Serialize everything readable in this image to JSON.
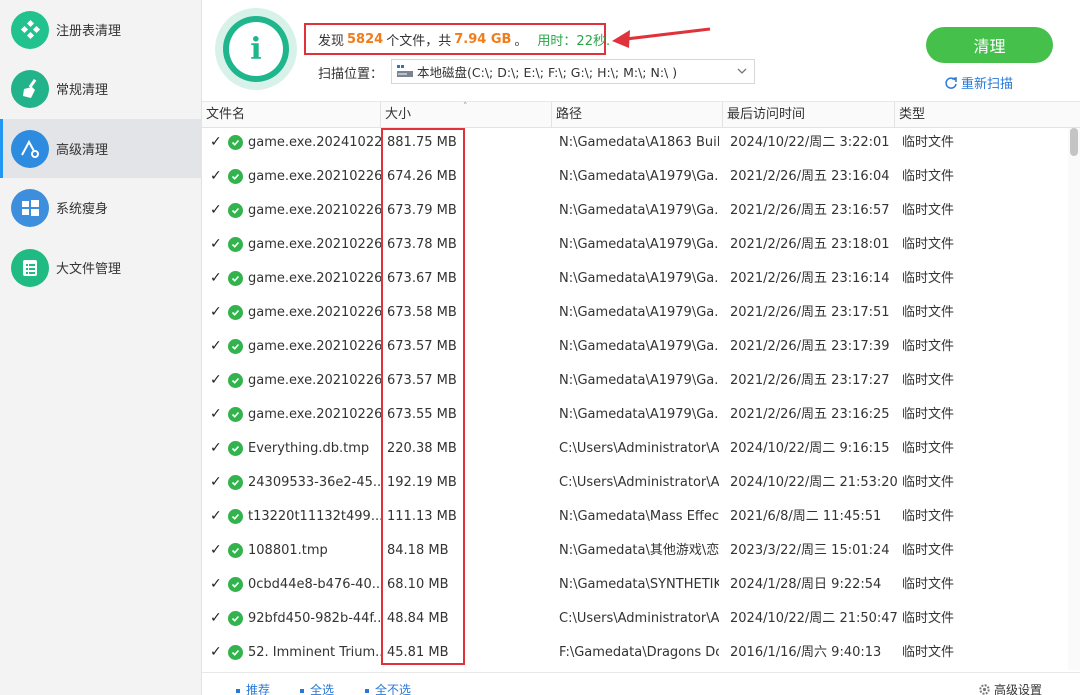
{
  "sidebar": {
    "items": [
      {
        "label": "注册表清理",
        "icon": "registry-icon",
        "color": "#22c28f"
      },
      {
        "label": "常规清理",
        "icon": "broom-icon",
        "color": "#22b38a"
      },
      {
        "label": "高级清理",
        "icon": "advanced-clean-icon",
        "color": "#2d8be0"
      },
      {
        "label": "系统瘦身",
        "icon": "windows-icon",
        "color": "#3d8fdd"
      },
      {
        "label": "大文件管理",
        "icon": "file-list-icon",
        "color": "#20ba83"
      }
    ],
    "active_index": 2
  },
  "summary": {
    "prefix": "发现",
    "count": "5824",
    "mid": "个文件，共",
    "size": "7.94 GB",
    "suffix": "。",
    "time": "用时：22秒."
  },
  "scan": {
    "label": "扫描位置：",
    "value": "本地磁盘(C:\\; D:\\; E:\\; F:\\; G:\\; H:\\; M:\\; N:\\ )"
  },
  "actions": {
    "clean_label": "清理",
    "rescan_label": "重新扫描"
  },
  "table": {
    "headers": [
      "文件名",
      "大小",
      "路径",
      "最后访问时间",
      "类型"
    ],
    "rows": [
      {
        "name": "game.exe.20241022...",
        "size": "881.75 MB",
        "path": "N:\\Gamedata\\A1863 Buil...",
        "time": "2024/10/22/周二 3:22:01",
        "type": "临时文件"
      },
      {
        "name": "game.exe.20210226...",
        "size": "674.26 MB",
        "path": "N:\\Gamedata\\A1979\\Ga...",
        "time": "2021/2/26/周五 23:16:04",
        "type": "临时文件"
      },
      {
        "name": "game.exe.20210226...",
        "size": "673.79 MB",
        "path": "N:\\Gamedata\\A1979\\Ga...",
        "time": "2021/2/26/周五 23:16:57",
        "type": "临时文件"
      },
      {
        "name": "game.exe.20210226...",
        "size": "673.78 MB",
        "path": "N:\\Gamedata\\A1979\\Ga...",
        "time": "2021/2/26/周五 23:18:01",
        "type": "临时文件"
      },
      {
        "name": "game.exe.20210226...",
        "size": "673.67 MB",
        "path": "N:\\Gamedata\\A1979\\Ga...",
        "time": "2021/2/26/周五 23:16:14",
        "type": "临时文件"
      },
      {
        "name": "game.exe.20210226...",
        "size": "673.58 MB",
        "path": "N:\\Gamedata\\A1979\\Ga...",
        "time": "2021/2/26/周五 23:17:51",
        "type": "临时文件"
      },
      {
        "name": "game.exe.20210226...",
        "size": "673.57 MB",
        "path": "N:\\Gamedata\\A1979\\Ga...",
        "time": "2021/2/26/周五 23:17:39",
        "type": "临时文件"
      },
      {
        "name": "game.exe.20210226...",
        "size": "673.57 MB",
        "path": "N:\\Gamedata\\A1979\\Ga...",
        "time": "2021/2/26/周五 23:17:27",
        "type": "临时文件"
      },
      {
        "name": "game.exe.20210226...",
        "size": "673.55 MB",
        "path": "N:\\Gamedata\\A1979\\Ga...",
        "time": "2021/2/26/周五 23:16:25",
        "type": "临时文件"
      },
      {
        "name": "Everything.db.tmp",
        "size": "220.38 MB",
        "path": "C:\\Users\\Administrator\\A...",
        "time": "2024/10/22/周二 9:16:15",
        "type": "临时文件"
      },
      {
        "name": "24309533-36e2-45...",
        "size": "192.19 MB",
        "path": "C:\\Users\\Administrator\\A...",
        "time": "2024/10/22/周二 21:53:20",
        "type": "临时文件"
      },
      {
        "name": "t13220t11132t499...",
        "size": "111.13 MB",
        "path": "N:\\Gamedata\\Mass Effect...",
        "time": "2021/6/8/周二 11:45:51",
        "type": "临时文件"
      },
      {
        "name": "108801.tmp",
        "size": "84.18 MB",
        "path": "N:\\Gamedata\\其他游戏\\恋...",
        "time": "2023/3/22/周三 15:01:24",
        "type": "临时文件"
      },
      {
        "name": "0cbd44e8-b476-40...",
        "size": "68.10 MB",
        "path": "N:\\Gamedata\\SYNTHETIK...",
        "time": "2024/1/28/周日 9:22:54",
        "type": "临时文件"
      },
      {
        "name": "92bfd450-982b-44f...",
        "size": "48.84 MB",
        "path": "C:\\Users\\Administrator\\A...",
        "time": "2024/10/22/周二 21:50:47",
        "type": "临时文件"
      },
      {
        "name": "52. Imminent Trium...",
        "size": "45.81 MB",
        "path": "F:\\Gamedata\\Dragons Do...",
        "time": "2016/1/16/周六 9:40:13",
        "type": "临时文件"
      }
    ]
  },
  "footer": {
    "recommend": "推荐",
    "select_all": "全选",
    "select_none": "全不选",
    "advanced": "高级设置"
  },
  "colors": {
    "accent_green": "#45c14b",
    "highlight_red": "#e0323b",
    "link_blue": "#2879d8",
    "number_orange": "#f07c1a"
  }
}
